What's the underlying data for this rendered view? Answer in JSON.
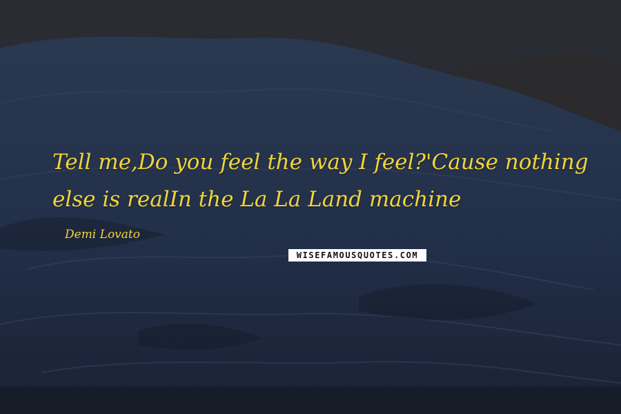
{
  "quote": {
    "text": "Tell me,Do you feel the way I feel?'Cause nothing else is realIn the La La Land machine",
    "author": "Demi Lovato"
  },
  "watermark": {
    "text": "WISEFAMOUSQUOTES.COM"
  },
  "colors": {
    "text": "#f2d43a",
    "background": "#1e2530",
    "watermark_bg": "#ffffff"
  }
}
